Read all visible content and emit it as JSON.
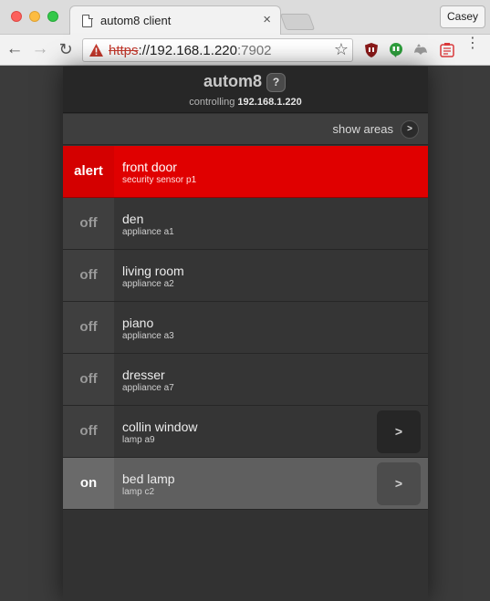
{
  "browser": {
    "tab_title": "autom8 client",
    "tab_close": "×",
    "profile_name": "Casey",
    "url_scheme": "https",
    "url_separator": "://",
    "url_host": "192.168.1.220",
    "url_port": ":7902",
    "nav_back": "←",
    "nav_forward": "→",
    "nav_reload": "↻",
    "bookmark_star": "☆",
    "menu": "⋮",
    "security_color": "#c5382c"
  },
  "app": {
    "title": "autom8",
    "help_label": "?",
    "controlling_prefix": "controlling",
    "controlling_host": "192.168.1.220",
    "show_areas_label": "show areas",
    "show_areas_button": ">",
    "alert_color": "#e00000"
  },
  "devices": [
    {
      "state": "alert",
      "name": "front door",
      "detail": "security sensor p1"
    },
    {
      "state": "off",
      "name": "den",
      "detail": "appliance a1"
    },
    {
      "state": "off",
      "name": "living room",
      "detail": "appliance a2"
    },
    {
      "state": "off",
      "name": "piano",
      "detail": "appliance a3"
    },
    {
      "state": "off",
      "name": "dresser",
      "detail": "appliance a7"
    },
    {
      "state": "off",
      "name": "collin window",
      "detail": "lamp a9",
      "action": ">"
    },
    {
      "state": "on",
      "name": "bed lamp",
      "detail": "lamp c2",
      "action": ">"
    }
  ]
}
